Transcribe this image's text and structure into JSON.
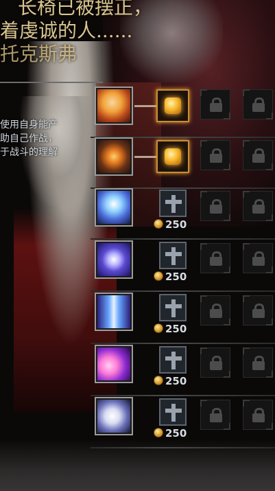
{
  "story": {
    "line1": "长椅已被摆正，",
    "line2": "着虔诚的人......",
    "line3": "托克斯弗"
  },
  "description": {
    "line1": "使用自身能产",
    "line2": "助自己作战，",
    "line3": "于战斗的理解"
  },
  "skills": [
    {
      "name": "skill-flame-swordsman",
      "state": "active",
      "cost": null,
      "colors": [
        "#f2a33a",
        "#e3d3b0"
      ]
    },
    {
      "name": "skill-fire-blade",
      "state": "active",
      "cost": null,
      "colors": [
        "#c45a14",
        "#3a2014"
      ]
    },
    {
      "name": "skill-white-haired",
      "state": "upgradeable",
      "cost": "250",
      "colors": [
        "#8fd1ff",
        "#4a6ad8"
      ]
    },
    {
      "name": "skill-vortex",
      "state": "upgradeable",
      "cost": "250",
      "colors": [
        "#b7b2ff",
        "#3a2f9a"
      ]
    },
    {
      "name": "skill-ice-shards",
      "state": "upgradeable",
      "cost": "250",
      "colors": [
        "#6aa8ff",
        "#2a1f7a"
      ]
    },
    {
      "name": "skill-crescent",
      "state": "upgradeable",
      "cost": "250",
      "colors": [
        "#ff7bd6",
        "#5a1a8a"
      ]
    },
    {
      "name": "skill-white-moon",
      "state": "upgradeable",
      "cost": "250",
      "colors": [
        "#ffffff",
        "#4a4f8a"
      ]
    }
  ],
  "colors": {
    "story_text": "#d9c48d",
    "active_slot_border": "#c98e34",
    "currency": "#f0b53a"
  },
  "icons": {
    "locked": "lock-icon",
    "upgrade": "upgrade-cross-icon",
    "currency": "coin-icon",
    "active": "orange-gem-icon"
  }
}
